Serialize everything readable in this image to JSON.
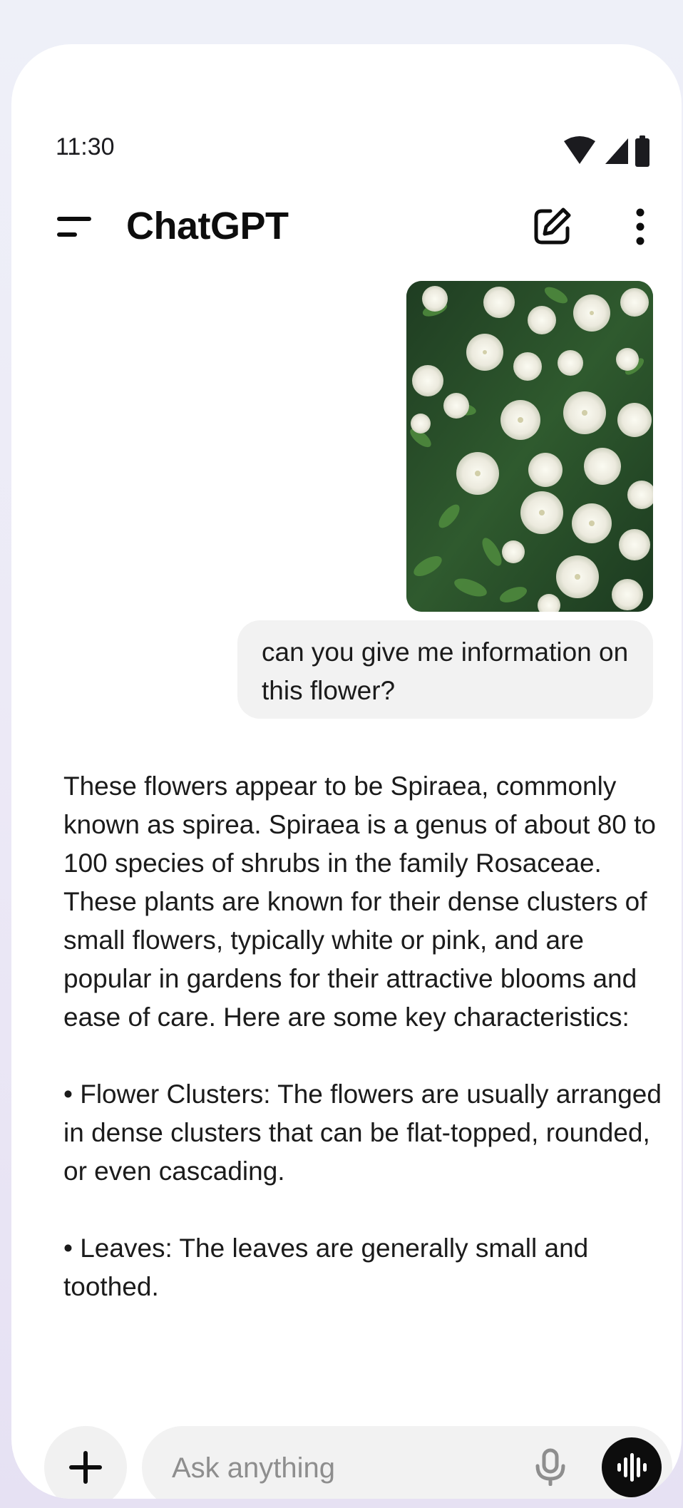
{
  "status_bar": {
    "time": "11:30",
    "icons": [
      "wifi-icon",
      "signal-icon",
      "battery-icon"
    ]
  },
  "header": {
    "menu_icon": "menu-icon",
    "title": "ChatGPT",
    "new_chat_icon": "edit-icon",
    "more_icon": "more-vertical-icon"
  },
  "conversation": {
    "user_message": {
      "image": "photo of white spirea flower clusters",
      "text": "can you give me information on this flower?"
    },
    "assistant_message": {
      "paragraphs": [
        "These flowers appear to be Spiraea, commonly known as spirea. Spiraea is a genus of about 80 to 100 species of shrubs in the family Rosaceae. These plants are known for their dense clusters of small flowers, typically white or pink, and are popular in gardens for their attractive blooms and ease of care. Here are some key characteristics:",
        "• Flower Clusters: The flowers are usually arranged in dense clusters that can be flat-topped, rounded, or even cascading.",
        "• Leaves: The leaves are generally small and toothed."
      ]
    }
  },
  "composer": {
    "add_icon": "plus-icon",
    "placeholder": "Ask anything",
    "mic_icon": "microphone-icon",
    "voice_icon": "voice-mode-icon"
  },
  "colors": {
    "background": "#ffffff",
    "bubble": "#f2f2f2",
    "text": "#1b1b1b",
    "voice_button": "#0d0d0d"
  }
}
